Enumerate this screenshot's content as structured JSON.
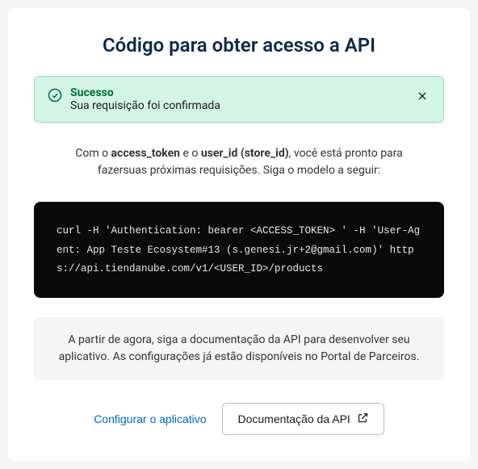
{
  "title": "Código para obter acesso a API",
  "alert": {
    "title": "Sucesso",
    "message": "Sua requisição foi confirmada"
  },
  "info": {
    "prefix": "Com o ",
    "token1": "access_token",
    "mid1": " e o ",
    "token2": "user_id (store_id)",
    "suffix": ", você está pronto para fazersuas próximas requisições. Siga o modelo a seguir:"
  },
  "code": "curl -H 'Authentication: bearer <ACCESS_TOKEN> ' -H 'User-Agent: App Teste Ecosystem#13 (s.genesi.jr+2@gmail.com)' https://api.tiendanube.com/v1/<USER_ID>/products",
  "note": "A partir de agora, siga a documentação da API para desenvolver seu aplicativo. As configurações já estão disponíveis no Portal de Parceiros.",
  "buttons": {
    "configure": "Configurar o aplicativo",
    "docs": "Documentação da API"
  }
}
